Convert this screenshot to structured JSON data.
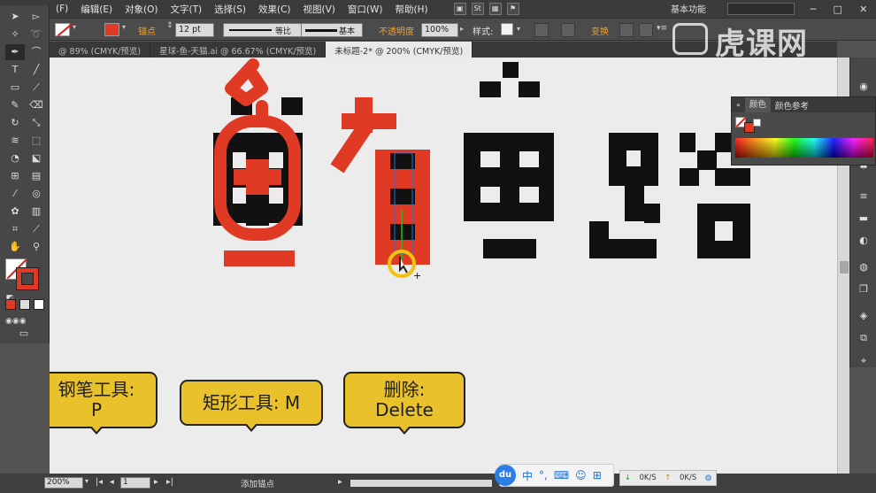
{
  "menu": {
    "items": [
      "(F)",
      "编辑(E)",
      "对象(O)",
      "文字(T)",
      "选择(S)",
      "效果(C)",
      "视图(V)",
      "窗口(W)",
      "帮助(H)"
    ],
    "workspace": "基本功能"
  },
  "control_bar": {
    "anchor_label": "锚点",
    "stroke_weight": "12 pt",
    "profile": "等比",
    "brush": "基本",
    "opacity_label": "不透明度",
    "opacity_value": "100%",
    "style_label": "样式:",
    "transform_label": "变换"
  },
  "tabs": [
    {
      "label": "@ 89% (CMYK/预览)",
      "active": false
    },
    {
      "label": "星球-鱼-天猫.ai @ 66.67% (CMYK/预览)",
      "active": false
    },
    {
      "label": "未标题-2* @ 200% (CMYK/预览)",
      "active": true
    }
  ],
  "color_panel": {
    "tabs": [
      "颜色",
      "颜色参考"
    ]
  },
  "callouts": [
    {
      "line1": "钢笔工具:",
      "line2": "P"
    },
    {
      "line1": "矩形工具: M",
      "line2": ""
    },
    {
      "line1": "删除:",
      "line2": "Delete"
    }
  ],
  "status": {
    "zoom": "200%",
    "page": "1",
    "tool_hint": "添加锚点"
  },
  "ime": {
    "logo": "du",
    "mode": "中"
  },
  "net": {
    "down": "0K/S",
    "up": "0K/S"
  },
  "watermark": {
    "text": "虎课网"
  },
  "colors": {
    "artwork_red": "#e03a25",
    "artwork_black": "#111111",
    "callout_yellow": "#e8c12b",
    "canvas_bg": "#ececec"
  },
  "icons": [
    "selection-icon",
    "direct-selection-icon",
    "magic-wand-icon",
    "lasso-icon",
    "pen-icon",
    "type-icon",
    "line-icon",
    "rectangle-icon",
    "brush-icon",
    "pencil-icon",
    "eraser-icon",
    "rotate-icon",
    "scale-icon",
    "warp-icon",
    "free-transform-icon",
    "shape-builder-icon",
    "mesh-icon",
    "gradient-icon",
    "eyedropper-icon",
    "blend-icon",
    "symbol-icon",
    "graph-icon",
    "artboard-icon",
    "slice-icon",
    "hand-icon",
    "zoom-icon"
  ]
}
